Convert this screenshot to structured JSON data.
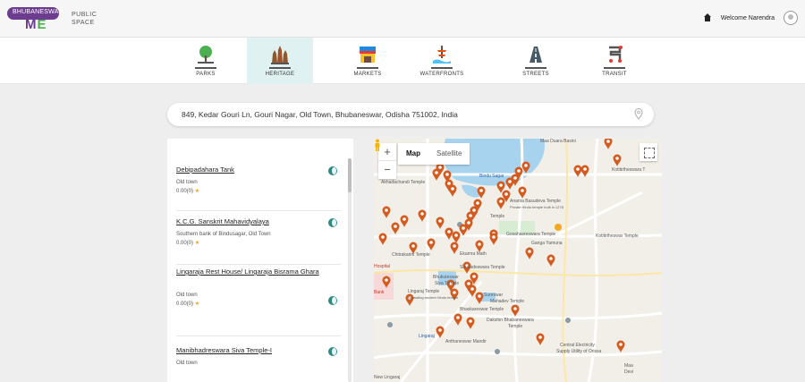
{
  "header": {
    "logo": {
      "badge": "BHUBANESWAR",
      "me_left": "M",
      "me_right": "E",
      "line1": "PUBLIC",
      "line2": "SPACE"
    },
    "welcome": "Welcome Narendra"
  },
  "categories": [
    {
      "label": "PARKS",
      "icon": "park-icon",
      "active": false
    },
    {
      "label": "HERITAGE",
      "icon": "heritage-temple-icon",
      "active": true
    },
    {
      "label": "MARKETS",
      "icon": "market-stall-icon",
      "active": false
    },
    {
      "label": "WATERFRONTS",
      "icon": "waterfront-icon",
      "active": false
    },
    {
      "label": "STREETS",
      "icon": "street-icon",
      "active": false
    },
    {
      "label": "TRANSIT",
      "icon": "transit-icon",
      "active": false
    }
  ],
  "search": {
    "value": "849, Kedar Gouri Ln, Gouri Nagar, Old Town, Bhubaneswar, Odisha 751002, India"
  },
  "places": [
    {
      "title": "Debipadahara Tank",
      "sub": "Old town",
      "rating": "0.00(0)"
    },
    {
      "title": "K.C.G. Sanskrit Mahavidyalaya",
      "sub": "Southern bank of Bindusagar, Old Town",
      "rating": "0.00(0)"
    },
    {
      "title": "Lingaraja Rest House/ Lingaraja Bisrama Ghara",
      "sub": "Old town",
      "rating": "0.00(0)"
    },
    {
      "title": "Manibhadreswara Siva Temple-I",
      "sub": "Old town",
      "rating": ""
    }
  ],
  "map": {
    "type_options": [
      "Map",
      "Satellite"
    ],
    "zoom_in": "+",
    "zoom_out": "−",
    "labels": {
      "maa_duara": "Maa Duara Basini",
      "kotitirtheswara": "Kotitirtheswara T",
      "bindu": "Bindu Sagar",
      "akhadachandi": "Akhadachandi Temple",
      "ananta": "Ananta Basudeva Temple",
      "ananta_sub": "Private Hindu temple built in 1278",
      "temple": "Temple",
      "kotitirtheswar2": "Kotitirtheswar Temple",
      "ganga": "Ganga Yamuna",
      "chitrakarini": "Chitrakarini Temple",
      "gosahasre": "Gosahasreswara Temple",
      "ekamra": "Ekamra Math",
      "hospital": "Hospital",
      "bank": "Bank",
      "lingaraj_temple": "Lingaraj Temple",
      "lingaraj_sub": "Sprawling ancient Hindu temple",
      "shukadeswara": "Shukadeswara Temple",
      "bhukuteswar": "Bhukuteswar",
      "siva": "Siva Temple",
      "sureswar": "Sureswar",
      "mahadev": "Mahadev Temple",
      "baital": "Bhaskareswar Temple",
      "dakshin": "Dakshin Bhabaneswara",
      "dakshin2": "Temple",
      "anthanuwar": "Anthaneswar Mandir",
      "central": "Central Electricity",
      "central2": "Supply Utility of Orissa",
      "lingaraj_road": "Lingaraj",
      "new_lingaraj": "New Lingaraj",
      "maa": "Maa",
      "devi": "Devi"
    }
  },
  "colors": {
    "accent_teal": "#2d8a83",
    "active_tab_bg": "#dff2f1",
    "marker": "#d35b1f",
    "brand_purple": "#6c3c8f",
    "water": "#a8d3ef"
  }
}
